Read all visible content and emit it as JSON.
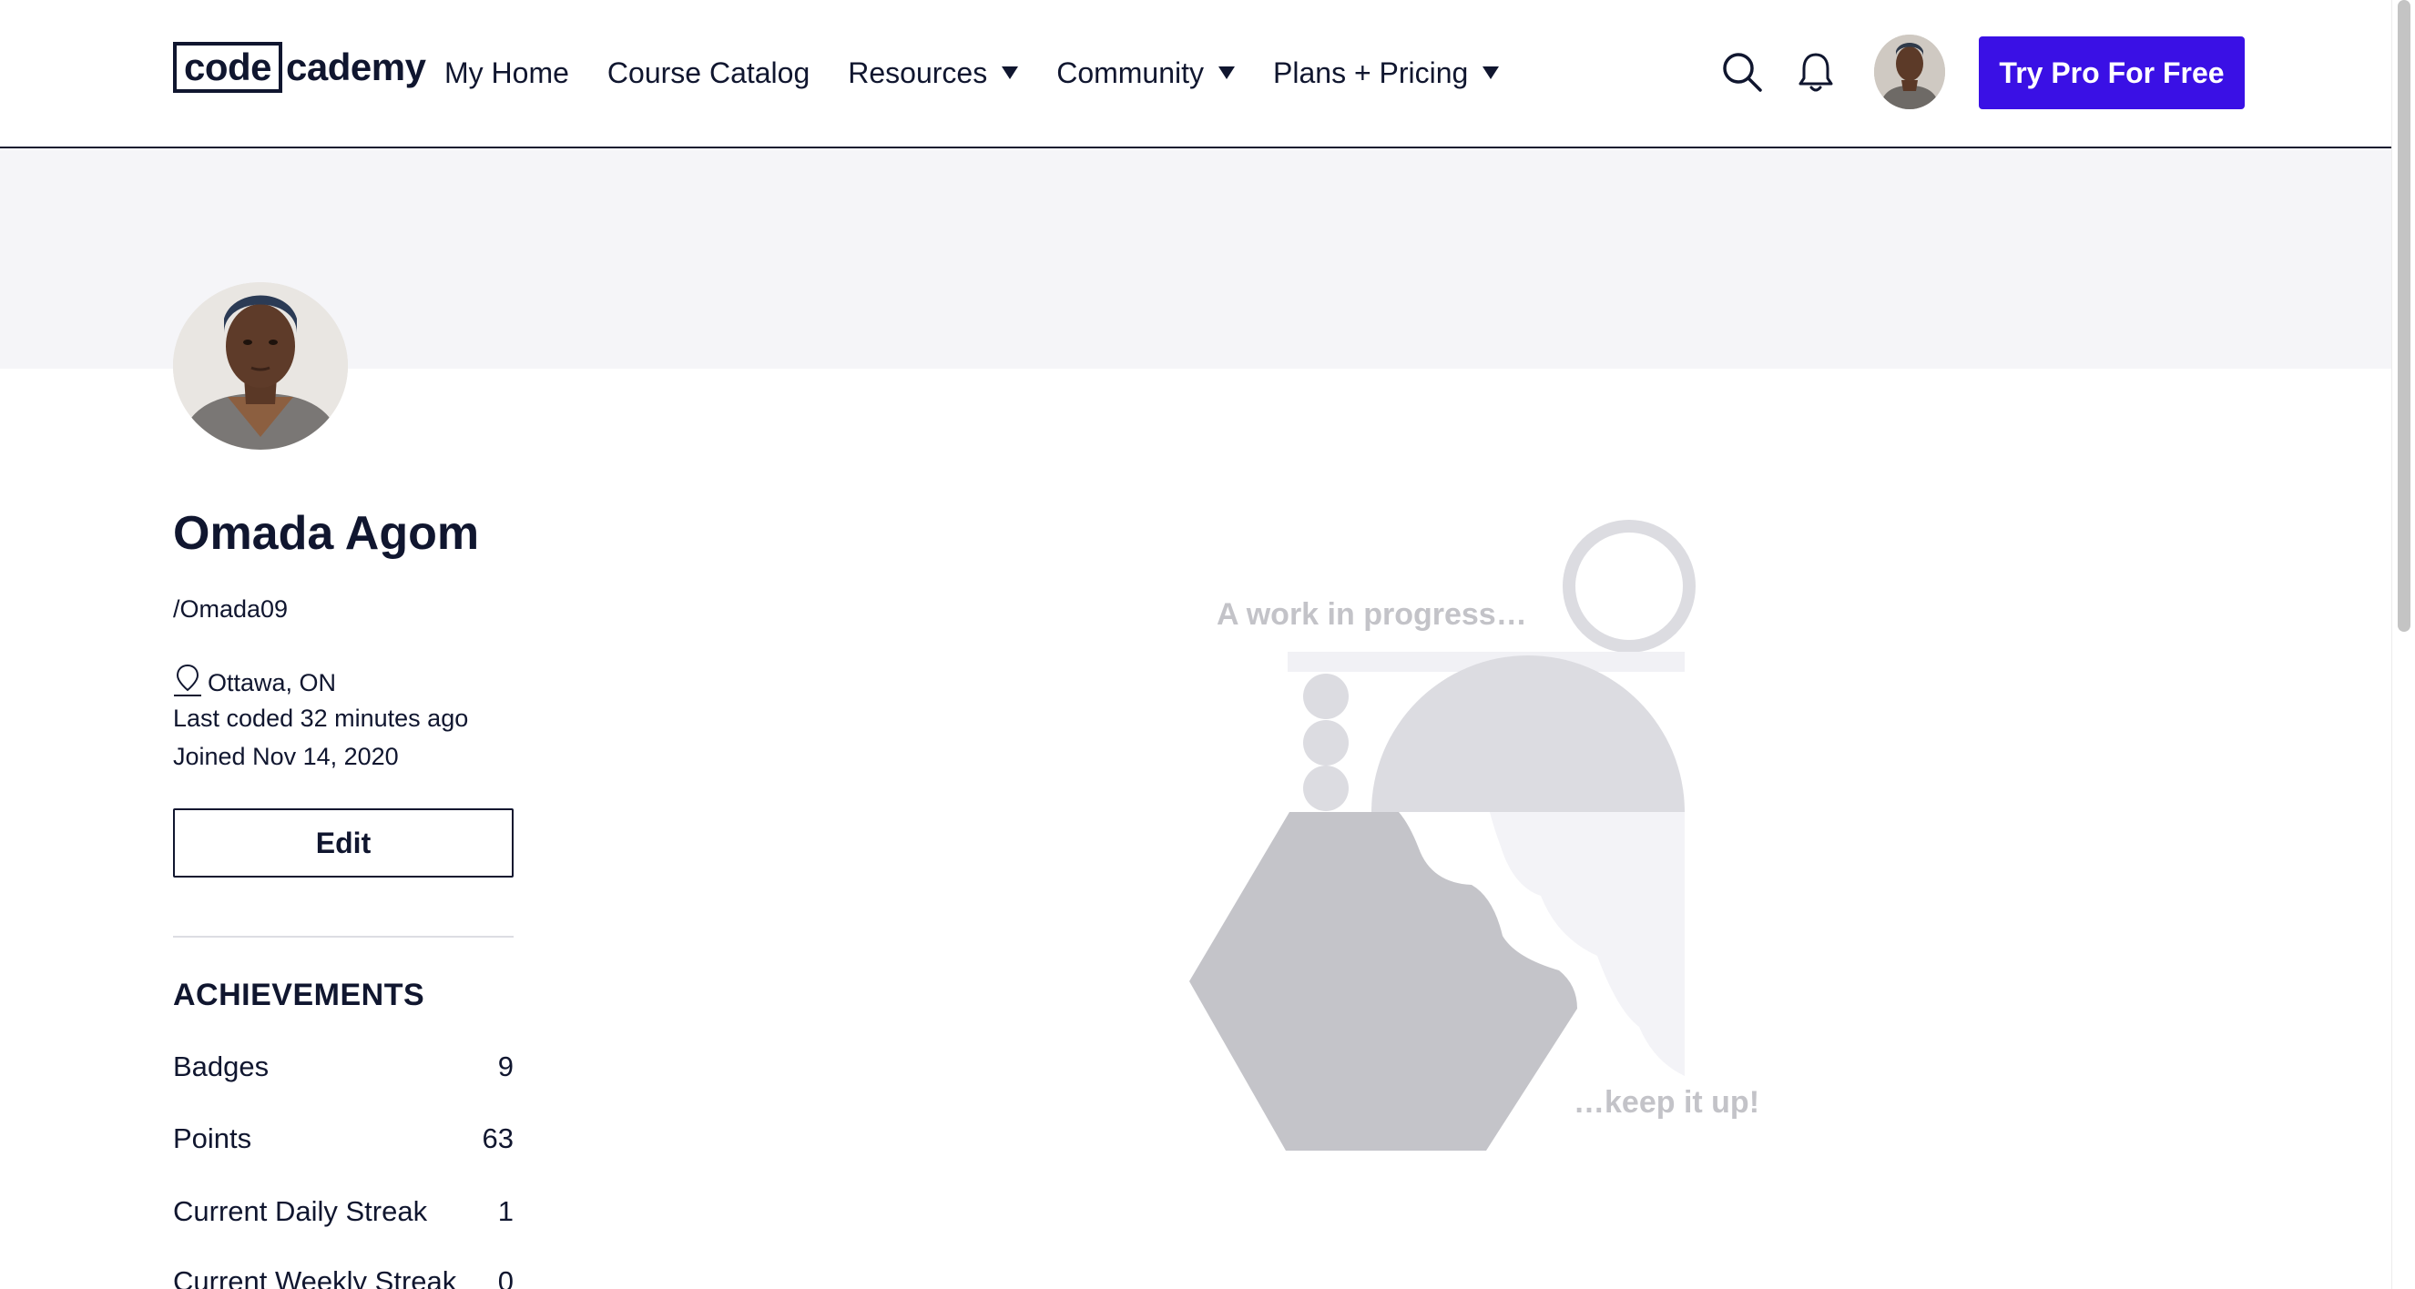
{
  "header": {
    "logo": {
      "code": "code",
      "cademy": "cademy"
    },
    "nav": [
      {
        "label": "My Home",
        "has_dropdown": false
      },
      {
        "label": "Course Catalog",
        "has_dropdown": false
      },
      {
        "label": "Resources",
        "has_dropdown": true
      },
      {
        "label": "Community",
        "has_dropdown": true
      },
      {
        "label": "Plans + Pricing",
        "has_dropdown": true
      }
    ],
    "icons": {
      "search": "search-icon",
      "notifications": "bell-icon"
    },
    "cta_label": "Try Pro For Free"
  },
  "profile": {
    "name": "Omada Agom",
    "username": "/Omada09",
    "location": "Ottawa, ON",
    "last_coded": "Last coded 32 minutes ago",
    "joined": "Joined Nov 14, 2020",
    "edit_label": "Edit"
  },
  "achievements": {
    "heading": "ACHIEVEMENTS",
    "items": [
      {
        "label": "Badges",
        "value": "9"
      },
      {
        "label": "Points",
        "value": "63"
      },
      {
        "label": "Current Daily Streak",
        "value": "1"
      },
      {
        "label": "Current Weekly Streak",
        "value": "0"
      }
    ]
  },
  "empty_state": {
    "top_text": "A work in progress…",
    "bottom_text": "…keep it up!"
  },
  "colors": {
    "brand_navy": "#10162f",
    "cta_blue": "#3a10e5",
    "banner_bg": "#f5f5f8",
    "illustration_gray": "#c4c4c9"
  }
}
